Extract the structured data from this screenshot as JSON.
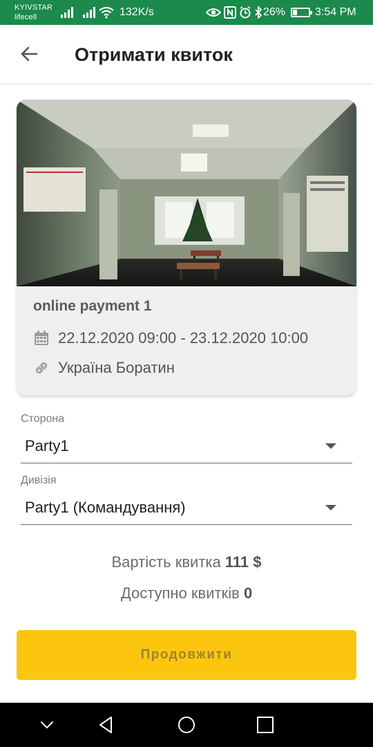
{
  "status_bar": {
    "carrier_1": "KYIVSTAR",
    "carrier_2": "lifecell",
    "network_speed": "132K/s",
    "battery_percent": "26%",
    "battery_level": 0.26,
    "time": "3:54 PM",
    "background": "#1b8a4c"
  },
  "app_bar": {
    "back_icon": "arrow-left-icon",
    "title": "Отримати квиток"
  },
  "event": {
    "image": "hallway-photo",
    "name": "online payment 1",
    "date_icon": "calendar-icon",
    "date_range": "22.12.2020 09:00 - 23.12.2020 10:00",
    "location_icon": "link-icon",
    "location": "Україна Боратин"
  },
  "form": {
    "side_label": "Сторона",
    "side_value": "Party1",
    "division_label": "Дивізія",
    "division_value": "Party1 (Командування)"
  },
  "ticket_info": {
    "price_label": "Вартість квитка",
    "price_value": "111 $",
    "available_label": "Доступно квитків",
    "available_value": "0"
  },
  "continue_button": {
    "label": "Продовжити",
    "color": "#fcc60f"
  },
  "nav_bar": {
    "icons": [
      "chevron-down-icon",
      "back-triangle-icon",
      "home-circle-icon",
      "recents-square-icon"
    ]
  }
}
